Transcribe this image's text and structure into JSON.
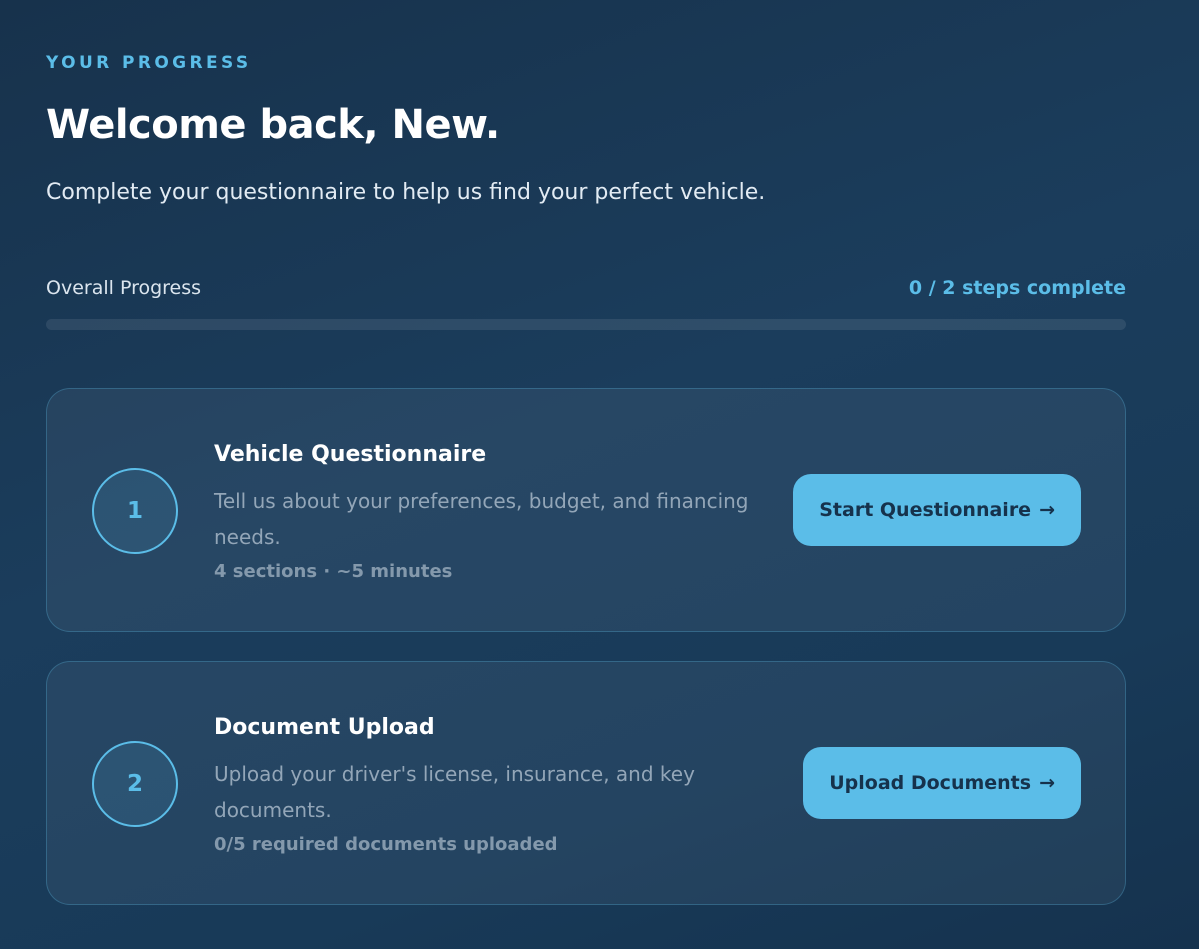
{
  "header": {
    "eyebrow": "YOUR PROGRESS",
    "title": "Welcome back, New.",
    "subtitle": "Complete your questionnaire to help us find your perfect vehicle."
  },
  "progress": {
    "label": "Overall Progress",
    "count_text": "0 / 2 steps complete",
    "completed": 0,
    "total": 2,
    "fraction": 0
  },
  "steps": [
    {
      "number": "1",
      "title": "Vehicle Questionnaire",
      "description": "Tell us about your preferences, budget, and financing needs.",
      "meta": "4 sections · ~5 minutes",
      "button_label": "Start Questionnaire",
      "button_icon": "arrow-right-icon"
    },
    {
      "number": "2",
      "title": "Document Upload",
      "description": "Upload your driver's license, insurance, and key documents.",
      "meta": "0/5 required documents uploaded",
      "button_label": "Upload Documents",
      "button_icon": "arrow-right-icon"
    }
  ],
  "colors": {
    "accent": "#5bbde8",
    "background": "#1b3d5c",
    "button_text": "#16324c"
  }
}
